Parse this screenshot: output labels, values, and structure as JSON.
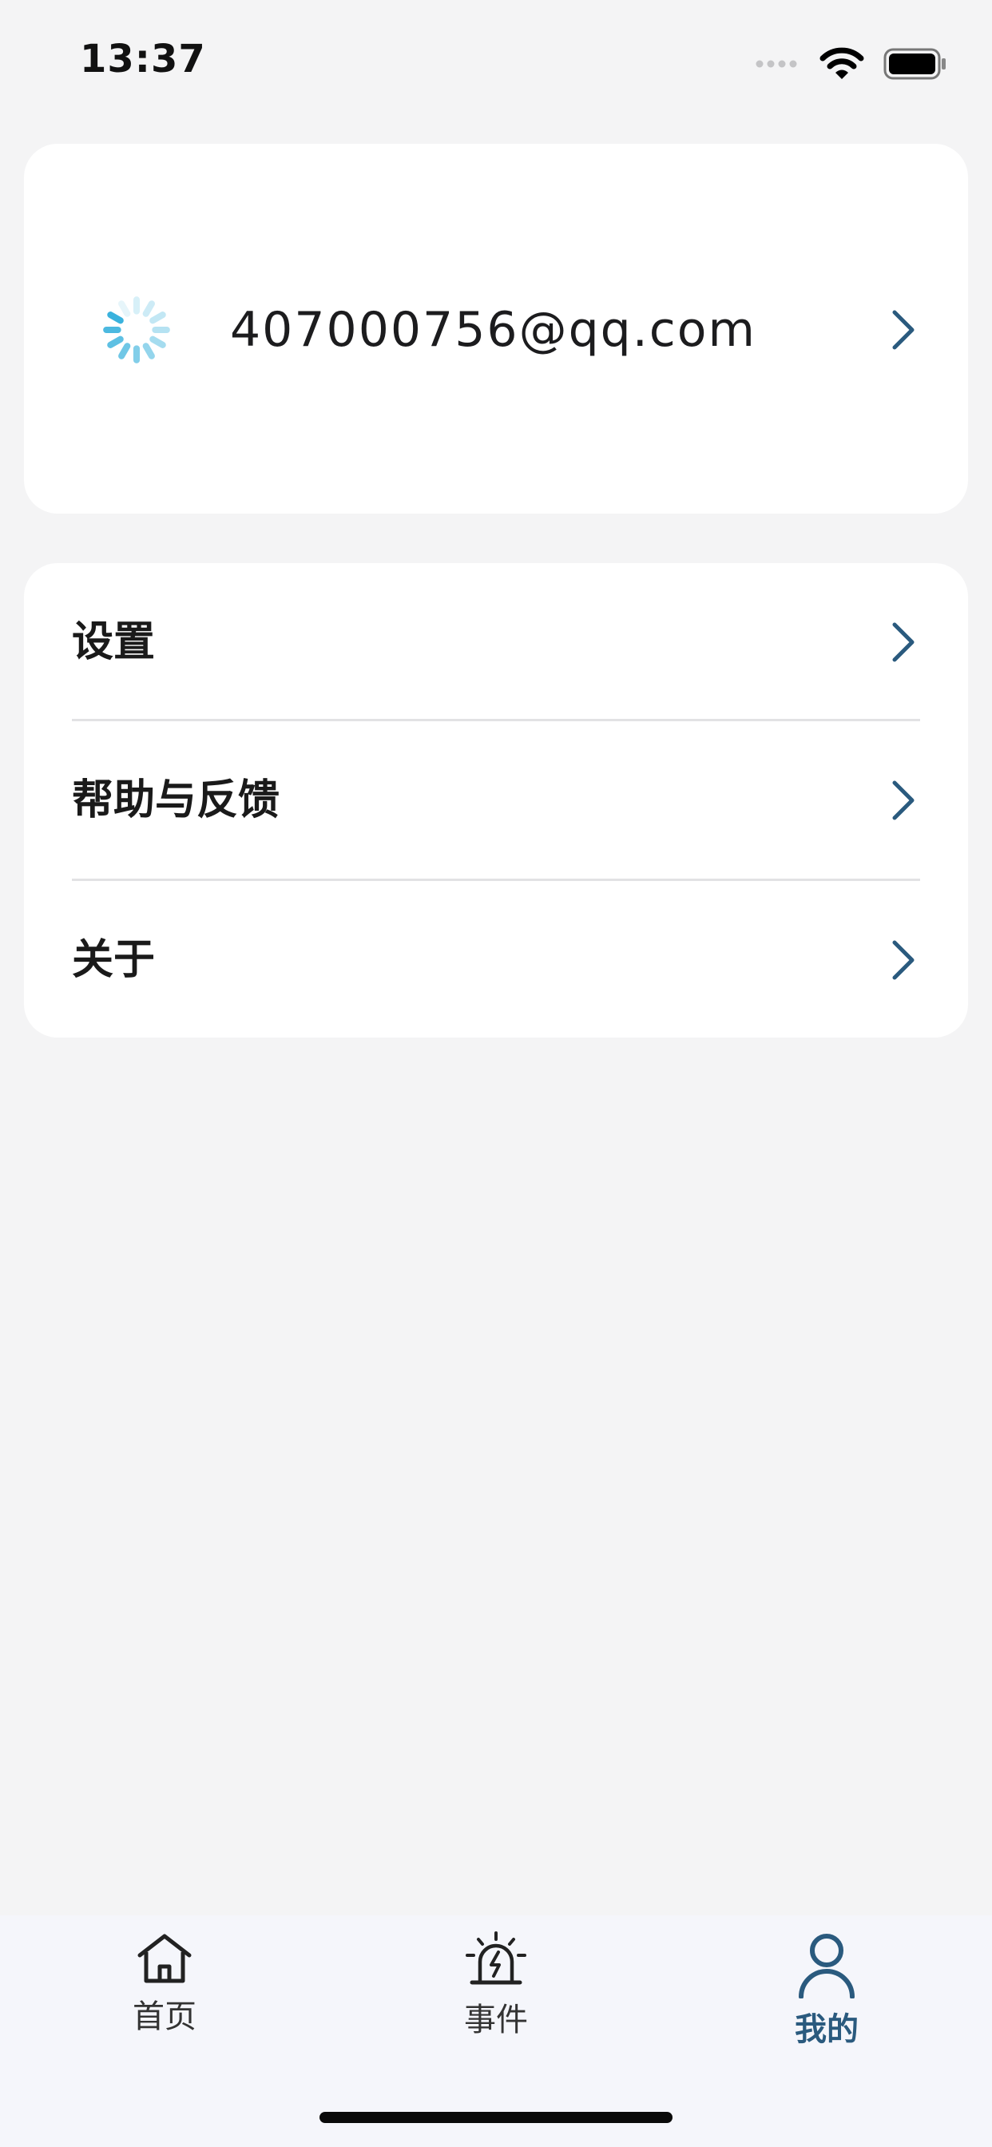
{
  "status_bar": {
    "time": "13:37",
    "icons": [
      "signal-icon",
      "wifi-icon",
      "battery-icon"
    ]
  },
  "profile": {
    "email": "407000756@qq.com",
    "avatar_icon": "loading-spinner-icon"
  },
  "menu": {
    "items": [
      {
        "label": "设置"
      },
      {
        "label": "帮助与反馈"
      },
      {
        "label": "关于"
      }
    ]
  },
  "tab_bar": {
    "tabs": [
      {
        "label": "首页",
        "icon": "home-icon",
        "active": false
      },
      {
        "label": "事件",
        "icon": "alarm-icon",
        "active": false
      },
      {
        "label": "我的",
        "icon": "user-icon",
        "active": true
      }
    ]
  },
  "colors": {
    "background": "#f4f4f5",
    "card": "#ffffff",
    "accent": "#2a5a7e",
    "spinner": "#3fb8e0",
    "tab_bar": "#f5f6fb"
  }
}
